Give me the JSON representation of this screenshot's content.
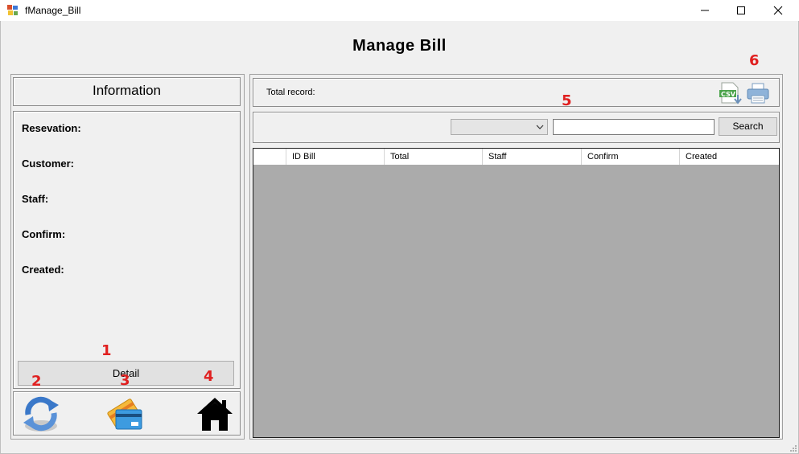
{
  "window": {
    "title": "fManage_Bill",
    "controls": {
      "minimize": "—",
      "maximize": "☐",
      "close": "✕"
    }
  },
  "page_title": "Manage Bill",
  "info_panel": {
    "header": "Information",
    "fields": [
      "Resevation:",
      "Customer:",
      "Staff:",
      "Confirm:",
      "Created:"
    ],
    "detail_button": "Detail"
  },
  "toolbar_icons": [
    "refresh-icon",
    "payment-card-icon",
    "home-icon"
  ],
  "records_bar": {
    "total_label": "Total record:",
    "icons": [
      "csv-export-icon",
      "printer-icon"
    ]
  },
  "search_bar": {
    "filter_selected": "",
    "search_value": "",
    "search_button": "Search"
  },
  "grid": {
    "columns": [
      "",
      "ID Bill",
      "Total",
      "Staff",
      "Confirm",
      "Created"
    ],
    "rows": []
  },
  "annotations": [
    "1",
    "2",
    "3",
    "4",
    "5",
    "6"
  ],
  "colors": {
    "background": "#f0f0f0",
    "grid_background": "#ababab",
    "annotation": "#e02020"
  }
}
